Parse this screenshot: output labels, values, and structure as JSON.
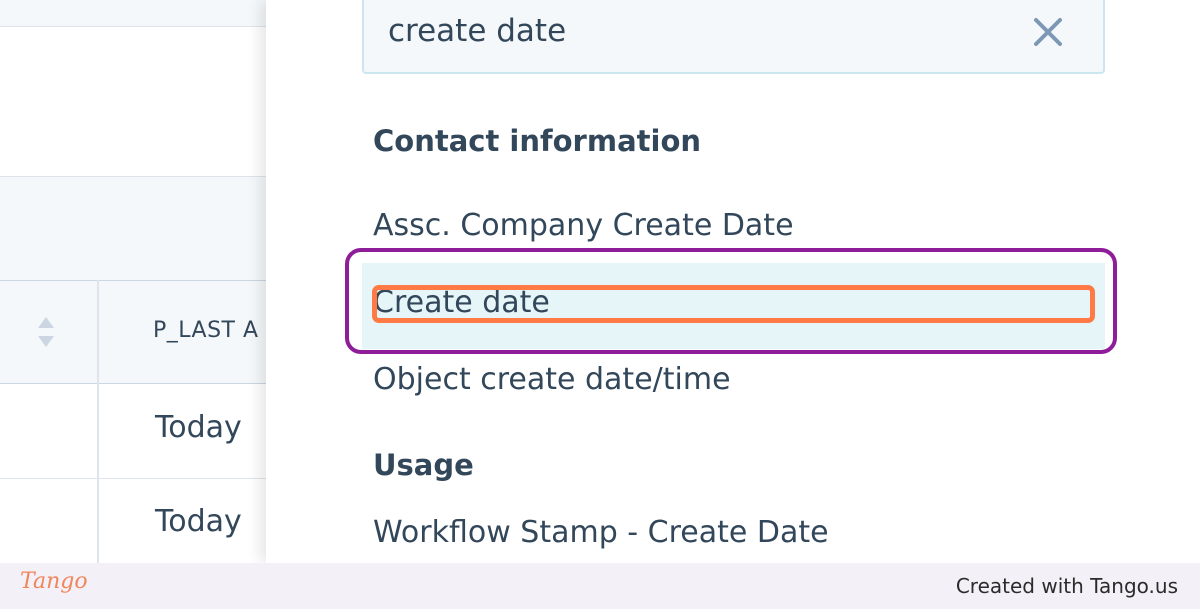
{
  "background_table": {
    "column_header": "P_LAST A",
    "rows": [
      "Today",
      "Today"
    ]
  },
  "panel": {
    "search": {
      "value": "create date",
      "clear_icon": "close-icon"
    },
    "sections": [
      {
        "title": "Contact information",
        "options": [
          "Assc. Company Create Date",
          "Create date",
          "Object create date/time"
        ]
      },
      {
        "title": "Usage",
        "options": [
          "Workflow Stamp - Create Date"
        ]
      }
    ],
    "highlighted_option": "Create date"
  },
  "footer": {
    "logo": "Tango",
    "credit": "Created with Tango.us"
  },
  "colors": {
    "accent_purple": "#8e1d99",
    "accent_orange": "#ff7a45",
    "highlight_bg": "#e5f5f8",
    "text": "#33475b"
  }
}
